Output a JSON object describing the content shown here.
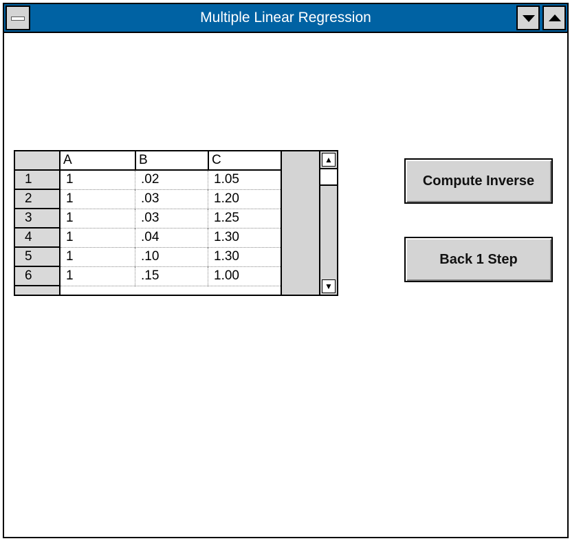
{
  "window": {
    "title": "Multiple Linear Regression"
  },
  "grid": {
    "columns": [
      "A",
      "B",
      "C"
    ],
    "rows": [
      {
        "num": "1",
        "cells": [
          "1",
          ".02",
          "1.05"
        ]
      },
      {
        "num": "2",
        "cells": [
          "1",
          ".03",
          "1.20"
        ]
      },
      {
        "num": "3",
        "cells": [
          "1",
          ".03",
          "1.25"
        ]
      },
      {
        "num": "4",
        "cells": [
          "1",
          ".04",
          "1.30"
        ]
      },
      {
        "num": "5",
        "cells": [
          "1",
          ".10",
          "1.30"
        ]
      },
      {
        "num": "6",
        "cells": [
          "1",
          ".15",
          "1.00"
        ]
      }
    ]
  },
  "buttons": {
    "compute_inverse": "Compute Inverse",
    "back_step": "Back 1 Step"
  },
  "icons": {
    "system_menu": "system-menu-icon",
    "minimize": "minimize-icon",
    "maximize": "maximize-icon",
    "scroll_up": "scroll-up-arrow-icon",
    "scroll_down": "scroll-down-arrow-icon"
  },
  "colors": {
    "titlebar": "#0062a3",
    "button_face": "#d4d4d4"
  }
}
